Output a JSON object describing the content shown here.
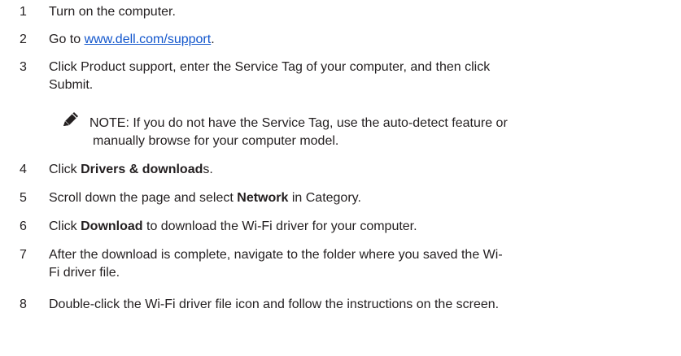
{
  "steps": [
    {
      "num": "1",
      "parts": [
        "Turn on the computer."
      ]
    },
    {
      "num": "2",
      "pre": "Go to ",
      "link": "www.dell.com/support",
      "post": "."
    },
    {
      "num": "3",
      "line1": "Click Product support, enter the Service Tag of your computer, and then click",
      "line2": "Submit."
    },
    {
      "num": "4",
      "pre": "Click ",
      "bold": "Drivers & download",
      "post": "s."
    },
    {
      "num": "5",
      "pre": "Scroll down the page and select ",
      "bold": "Network",
      "post": " in Category."
    },
    {
      "num": "6",
      "pre": "Click ",
      "bold": "Download",
      "post": " to download the Wi-Fi driver for your computer."
    },
    {
      "num": "7",
      "line1": "After the download is complete, navigate to the folder where you saved the Wi-",
      "line2": "Fi driver file."
    },
    {
      "num": "8",
      "parts": [
        "Double-click the Wi-Fi driver file icon and follow the instructions on the screen."
      ]
    }
  ],
  "note": {
    "icon": "pencil-icon",
    "line1": "NOTE: If you do not have the Service Tag, use the auto-detect feature or",
    "line2": "manually browse for your computer model."
  }
}
